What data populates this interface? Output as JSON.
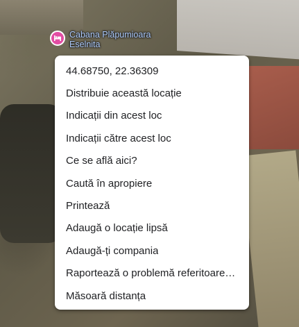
{
  "poi": {
    "name": "Cabana Plăpumioara",
    "locality": "Eselnita",
    "icon": "hotel-icon",
    "icon_color": "#e24da3",
    "label_color": "#aecbfa"
  },
  "context_menu": {
    "items": [
      {
        "label": "44.68750, 22.36309"
      },
      {
        "label": "Distribuie această locație"
      },
      {
        "label": "Indicații din acest loc"
      },
      {
        "label": "Indicații către acest loc"
      },
      {
        "label": "Ce se află aici?"
      },
      {
        "label": "Caută în apropiere"
      },
      {
        "label": "Printează"
      },
      {
        "label": "Adaugă o locație lipsă"
      },
      {
        "label": "Adaugă-ți compania"
      },
      {
        "label": "Raportează o problemă referitoare la date"
      },
      {
        "label": "Măsoară distanța"
      }
    ]
  }
}
